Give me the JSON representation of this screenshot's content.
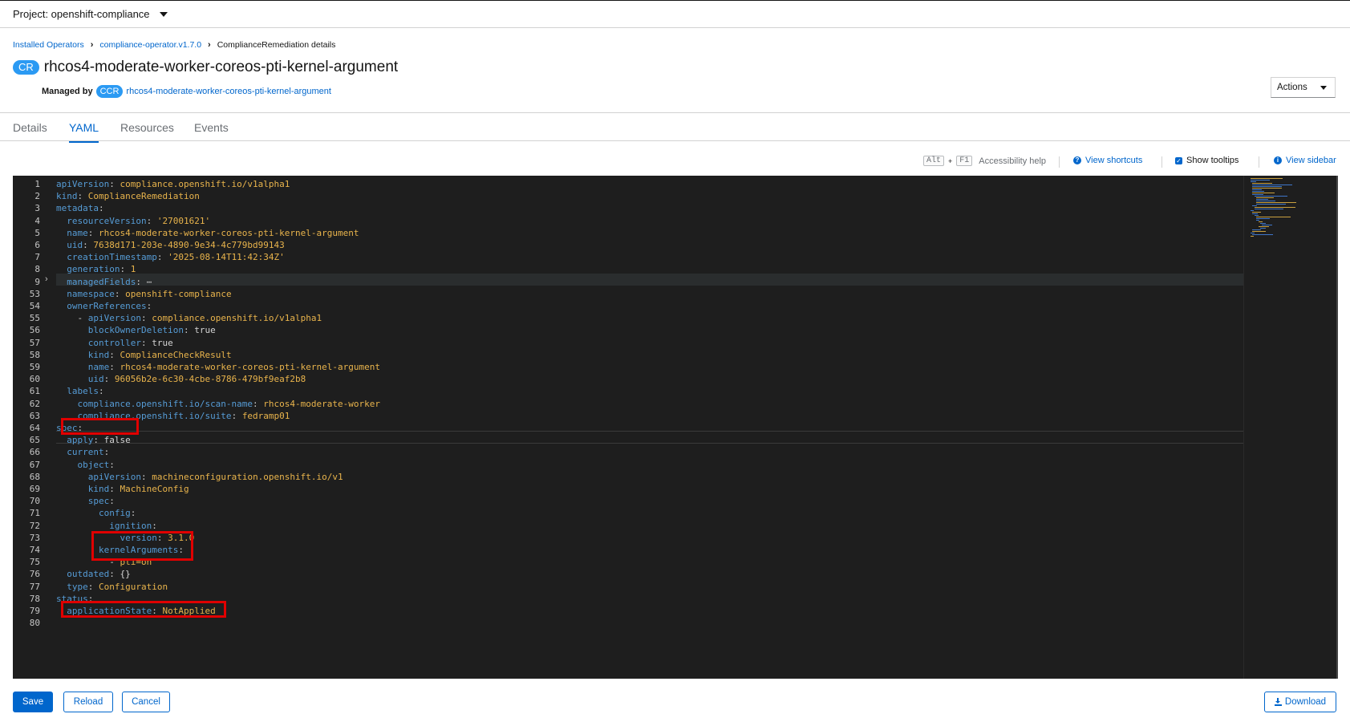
{
  "project": {
    "label": "Project: openshift-compliance"
  },
  "breadcrumb": [
    {
      "label": "Installed Operators"
    },
    {
      "label": "compliance-operator.v1.7.0"
    },
    {
      "label": "ComplianceRemediation details"
    }
  ],
  "header": {
    "badge": "CR",
    "title": "rhcos4-moderate-worker-coreos-pti-kernel-argument",
    "managed_by_label": "Managed by",
    "managed_badge": "CCR",
    "managed_link": "rhcos4-moderate-worker-coreos-pti-kernel-argument",
    "actions_label": "Actions"
  },
  "tabs": [
    {
      "label": "Details",
      "active": false
    },
    {
      "label": "YAML",
      "active": true
    },
    {
      "label": "Resources",
      "active": false
    },
    {
      "label": "Events",
      "active": false
    }
  ],
  "toolbar": {
    "key1": "Alt",
    "plus": "+",
    "key2": "F1",
    "accessibility": "Accessibility help",
    "shortcuts": "View shortcuts",
    "tooltips": "Show tooltips",
    "sidebar": "View sidebar"
  },
  "editor": {
    "lines": [
      {
        "n": "1",
        "k": "apiVersion",
        "v": "compliance.openshift.io/v1alpha1"
      },
      {
        "n": "2",
        "k": "kind",
        "v": "ComplianceRemediation"
      },
      {
        "n": "3",
        "k": "metadata",
        "v": ""
      },
      {
        "n": "4",
        "k": "  resourceVersion",
        "v": "'27001621'"
      },
      {
        "n": "5",
        "k": "  name",
        "v": "rhcos4-moderate-worker-coreos-pti-kernel-argument"
      },
      {
        "n": "6",
        "k": "  uid",
        "v": "7638d171-203e-4890-9e34-4c779bd99143"
      },
      {
        "n": "7",
        "k": "  creationTimestamp",
        "v": "'2025-08-14T11:42:34Z'"
      },
      {
        "n": "8",
        "k": "  generation",
        "v": "1"
      },
      {
        "n": "9",
        "k": "  managedFields",
        "v": "⋯"
      },
      {
        "n": "53",
        "k": "  namespace",
        "v": "openshift-compliance"
      },
      {
        "n": "54",
        "k": "  ownerReferences",
        "v": ""
      },
      {
        "n": "55",
        "k": "    - apiVersion",
        "v": "compliance.openshift.io/v1alpha1"
      },
      {
        "n": "56",
        "k": "      blockOwnerDeletion",
        "v": "true"
      },
      {
        "n": "57",
        "k": "      controller",
        "v": "true"
      },
      {
        "n": "58",
        "k": "      kind",
        "v": "ComplianceCheckResult"
      },
      {
        "n": "59",
        "k": "      name",
        "v": "rhcos4-moderate-worker-coreos-pti-kernel-argument"
      },
      {
        "n": "60",
        "k": "      uid",
        "v": "96056b2e-6c30-4cbe-8786-479bf9eaf2b8"
      },
      {
        "n": "61",
        "k": "  labels",
        "v": ""
      },
      {
        "n": "62",
        "k": "    compliance.openshift.io/scan-name",
        "v": "rhcos4-moderate-worker"
      },
      {
        "n": "63",
        "k": "    compliance.openshift.io/suite",
        "v": "fedramp01"
      },
      {
        "n": "64",
        "k": "spec",
        "v": ""
      },
      {
        "n": "65",
        "k": "  apply",
        "v": "false"
      },
      {
        "n": "66",
        "k": "  current",
        "v": ""
      },
      {
        "n": "67",
        "k": "    object",
        "v": ""
      },
      {
        "n": "68",
        "k": "      apiVersion",
        "v": "machineconfiguration.openshift.io/v1"
      },
      {
        "n": "69",
        "k": "      kind",
        "v": "MachineConfig"
      },
      {
        "n": "70",
        "k": "      spec",
        "v": ""
      },
      {
        "n": "71",
        "k": "        config",
        "v": ""
      },
      {
        "n": "72",
        "k": "          ignition",
        "v": ""
      },
      {
        "n": "73",
        "k": "            version",
        "v": "3.1.0"
      },
      {
        "n": "74",
        "k": "        kernelArguments",
        "v": ""
      },
      {
        "n": "75",
        "k": "          - pti=on",
        "v": null
      },
      {
        "n": "76",
        "k": "  outdated",
        "v": "{}"
      },
      {
        "n": "77",
        "k": "  type",
        "v": "Configuration"
      },
      {
        "n": "78",
        "k": "status",
        "v": ""
      },
      {
        "n": "79",
        "k": "  applicationState",
        "v": "NotApplied"
      },
      {
        "n": "80",
        "k": "",
        "v": null
      }
    ]
  },
  "footer": {
    "save": "Save",
    "reload": "Reload",
    "cancel": "Cancel",
    "download": "Download"
  }
}
